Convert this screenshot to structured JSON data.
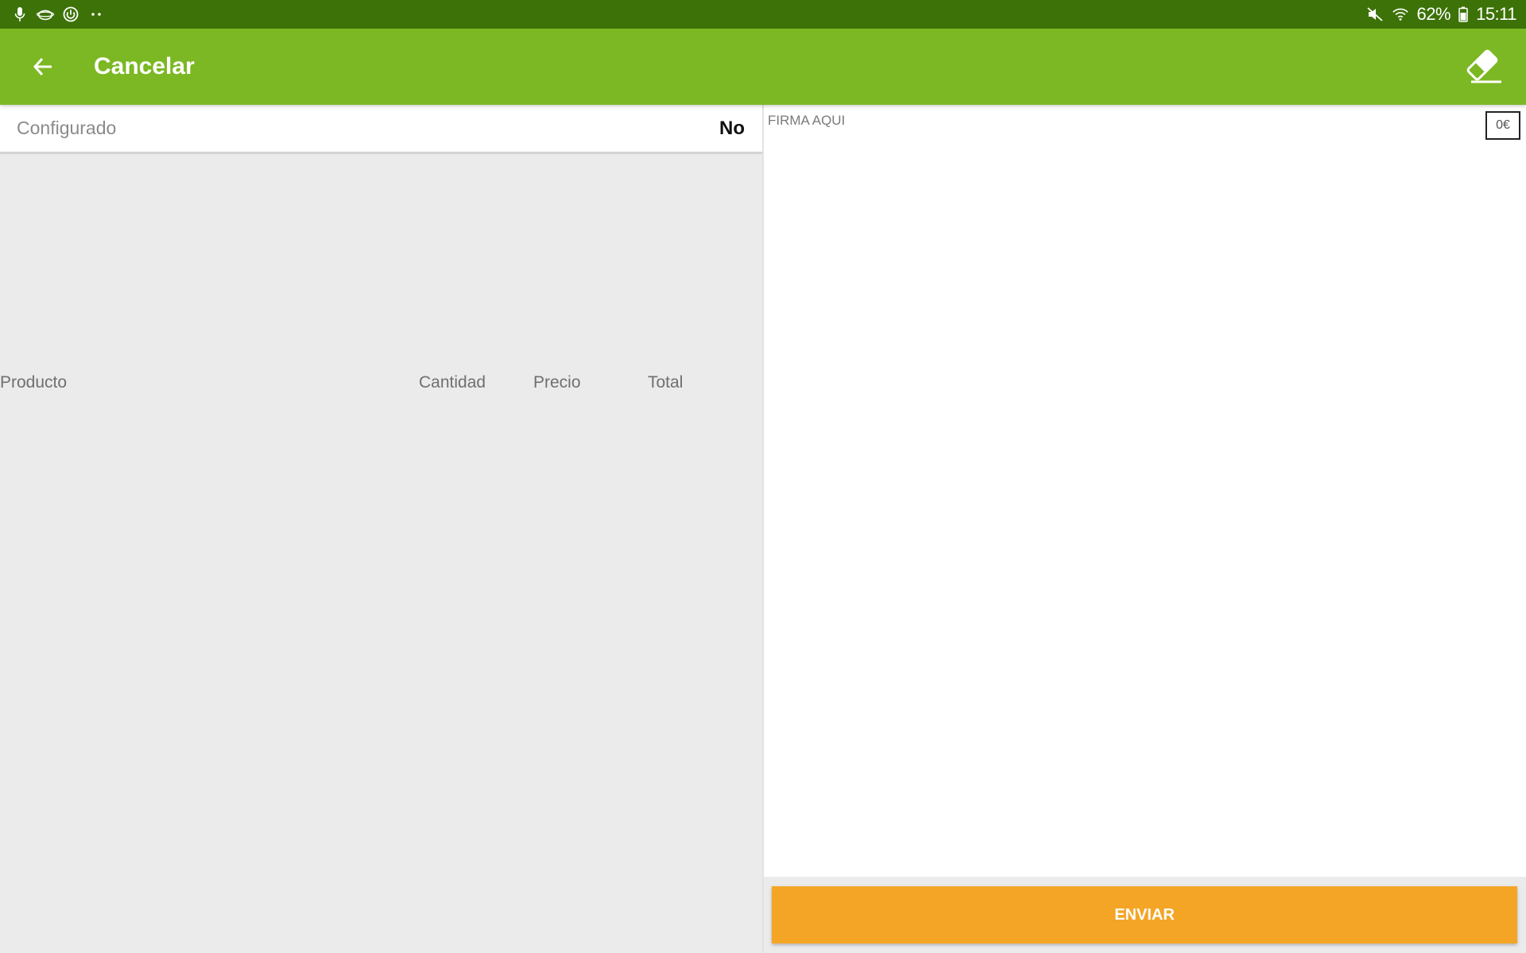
{
  "status_bar": {
    "left_icons": [
      "microphone-icon",
      "cloud-icon",
      "sync-icon",
      "more-dots-icon"
    ],
    "battery_percent": "62%",
    "time": "15:11",
    "right_icons": [
      "mute-icon",
      "wifi-icon",
      "battery-icon"
    ]
  },
  "app_bar": {
    "title": "Cancelar",
    "back_icon": "arrow-back-icon",
    "action_icon": "eraser-icon",
    "color": "#7cb823"
  },
  "config": {
    "label": "Configurado",
    "value": "No"
  },
  "table": {
    "headers": [
      "Producto",
      "Cantidad",
      "Precio",
      "Total"
    ],
    "rows": []
  },
  "signature": {
    "hint": "FIRMA AQUI",
    "total": "0€"
  },
  "send_button": {
    "label": "ENVIAR",
    "color": "#f4a526"
  }
}
